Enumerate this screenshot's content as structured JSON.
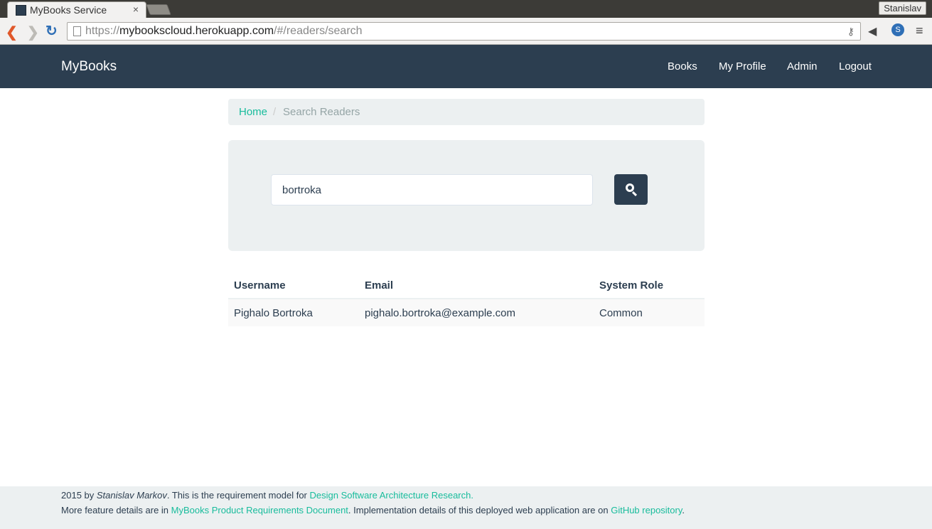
{
  "browser": {
    "tab_title": "MyBooks Service",
    "tab_close": "×",
    "profile_name": "Stanislav",
    "url_scheme": "https://",
    "url_host": "mybookscloud.herokuapp.com",
    "url_path": "/#/readers/search",
    "icons": {
      "back": "❮",
      "forward": "❯",
      "reload": "↻",
      "key": "⚷",
      "extension": "◀",
      "skype": "S",
      "menu": "≡"
    }
  },
  "navbar": {
    "brand": "MyBooks",
    "links": [
      "Books",
      "My Profile",
      "Admin",
      "Logout"
    ]
  },
  "breadcrumb": {
    "home": "Home",
    "separator": "/",
    "current": "Search Readers"
  },
  "search": {
    "value": "bortroka"
  },
  "results": {
    "columns": [
      "Username",
      "Email",
      "System Role"
    ],
    "rows": [
      [
        "Pighalo Bortroka",
        "pighalo.bortroka@example.com",
        "Common"
      ]
    ]
  },
  "footer": {
    "line1_prefix": "2015 by ",
    "line1_author": "Stanislav Markov",
    "line1_middle": ". This is the requirement model for ",
    "line1_link": "Design Software Architecture Research.",
    "line2_prefix": "More feature details are in ",
    "line2_link1": "MyBooks Product Requirements Document",
    "line2_middle": ". Implementation details of this deployed web application are on ",
    "line2_link2": "GitHub repository",
    "line2_suffix": "."
  },
  "colors": {
    "navbar": "#2c3e50",
    "accent": "#18bc9c",
    "panel": "#ecf0f1"
  }
}
